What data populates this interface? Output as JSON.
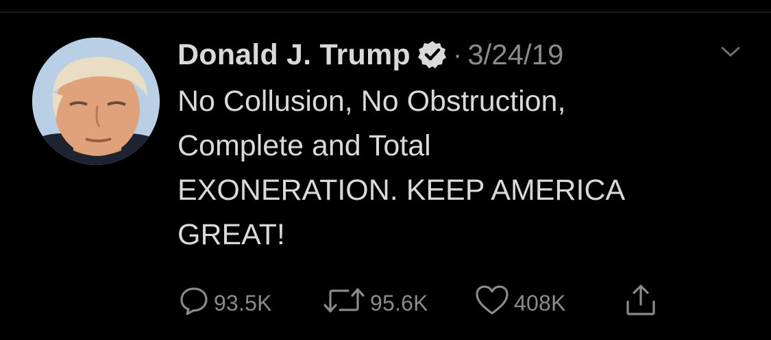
{
  "tweet": {
    "author_name": "Donald J. Trump",
    "separator": "·",
    "date": "3/24/19",
    "text": "No Collusion, No Obstruction,\nComplete and Total\nEXONERATION. KEEP AMERICA\nGREAT!"
  },
  "actions": {
    "replies": "93.5K",
    "retweets": "95.6K",
    "likes": "408K"
  },
  "icons": {
    "verified": "verified-badge-icon",
    "menu": "chevron-down-icon",
    "reply": "reply-bubble-icon",
    "retweet": "retweet-icon",
    "like": "heart-icon",
    "share": "share-icon"
  },
  "colors": {
    "background": "#000000",
    "primary_text": "#d9d9d9",
    "secondary_text": "#8b8b8f"
  }
}
